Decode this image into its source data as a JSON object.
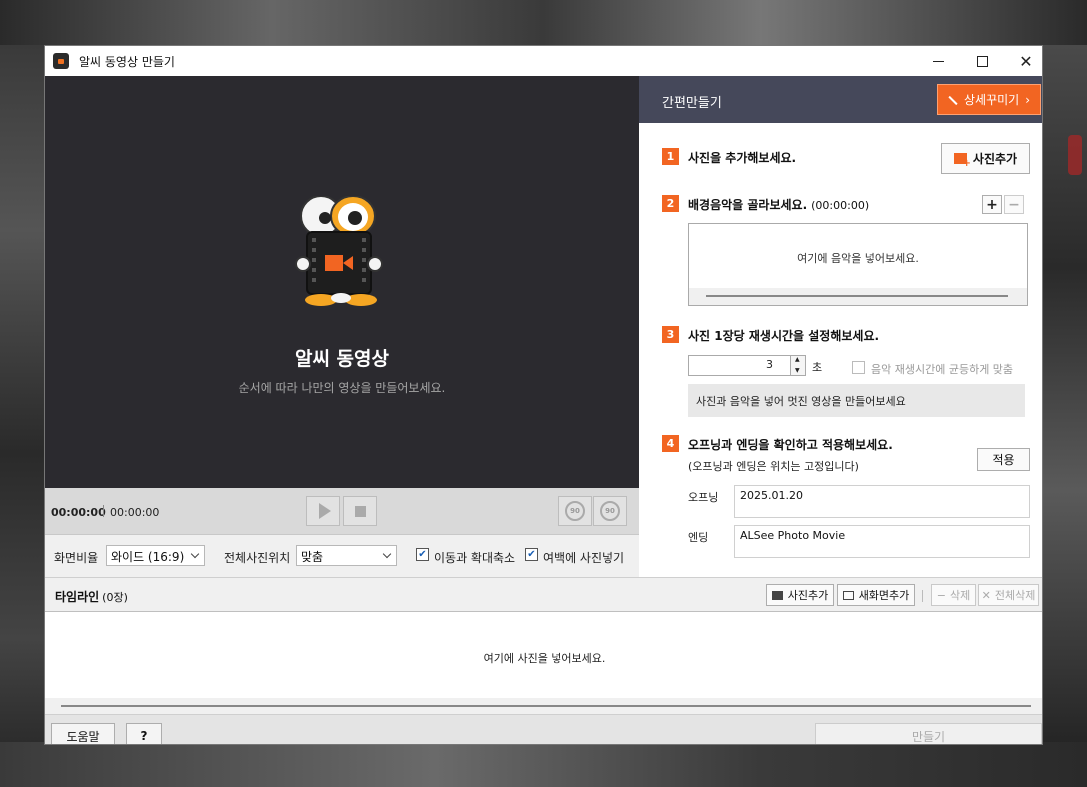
{
  "window": {
    "title": "알씨 동영상 만들기"
  },
  "preview": {
    "title": "알씨 동영상",
    "subtitle": "순서에 따라 나만의 영상을 만들어보세요."
  },
  "player": {
    "current_time": "00:00:00",
    "total_time": "00:00:00",
    "rotate_left_label": "90",
    "rotate_right_label": "90"
  },
  "options": {
    "aspect_label": "화면비율",
    "aspect_value": "와이드 (16:9)",
    "position_label": "전체사진위치",
    "position_value": "맞춤",
    "motion_label": "이동과 확대축소",
    "margin_label": "여백에 사진넣기"
  },
  "panel": {
    "title": "간편만들기",
    "detail_button": "상세꾸미기",
    "steps": [
      {
        "num": "1",
        "title": "사진을 추가해보세요."
      },
      {
        "num": "2",
        "title": "배경음악을 골라보세요.",
        "extra": "(00:00:00)"
      },
      {
        "num": "3",
        "title": "사진 1장당 재생시간을 설정해보세요."
      },
      {
        "num": "4",
        "title": "오프닝과 엔딩을 확인하고 적용해보세요.",
        "sub": "(오프닝과 엔딩은 위치는 고정입니다)"
      }
    ],
    "add_photo_button": "사진추가",
    "music_plus": "+",
    "music_minus": "−",
    "music_hint": "여기에 음악을 넣어보세요.",
    "duration_value": "3",
    "duration_unit": "초",
    "even_label": "음악 재생시간에 균등하게 맞춤",
    "info_text": "사진과 음악을 넣어 멋진 영상을 만들어보세요",
    "apply_button": "적용",
    "opening_label": "오프닝",
    "opening_value": "2025.01.20",
    "ending_label": "엔딩",
    "ending_value": "ALSee Photo Movie"
  },
  "timeline": {
    "title": "타임라인",
    "count": "(0장)",
    "add_photo": "사진추가",
    "add_blank": "새화면추가",
    "delete": "삭제",
    "delete_all": "전체삭제",
    "hint": "여기에 사진을 넣어보세요."
  },
  "footer": {
    "help": "도움말",
    "question": "?",
    "make": "만들기"
  },
  "colors": {
    "accent": "#f26522",
    "panel_header": "#45485a",
    "preview_bg": "#2b2a2f"
  }
}
